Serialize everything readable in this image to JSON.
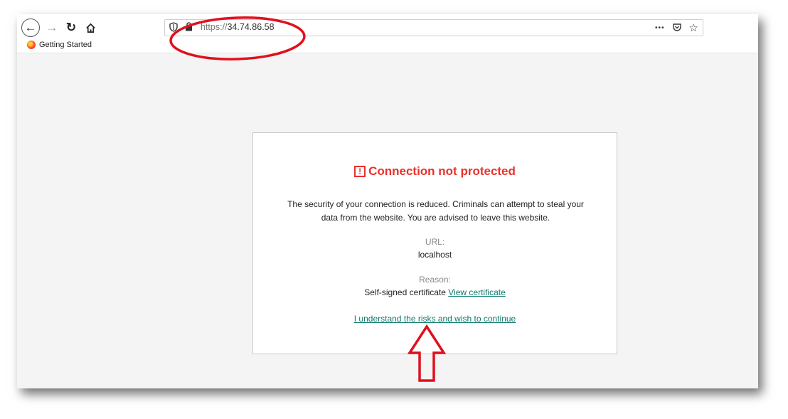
{
  "browser": {
    "url_protocol": "https://",
    "url_host": "34.74.86.58",
    "bookmark_label": "Getting Started",
    "more_label": "•••"
  },
  "page": {
    "title": "Connection not protected",
    "description": "The security of your connection is reduced. Criminals can attempt to steal your data from the website. You are advised to leave this website.",
    "url_label": "URL:",
    "url_value": "localhost",
    "reason_label": "Reason:",
    "reason_value": "Self-signed certificate",
    "view_certificate_link": "View certificate",
    "continue_link": "I understand the risks and wish to continue"
  },
  "colors": {
    "error_red": "#e8322c",
    "link_teal": "#0e7a6b",
    "annotation_red": "#e0101e"
  }
}
